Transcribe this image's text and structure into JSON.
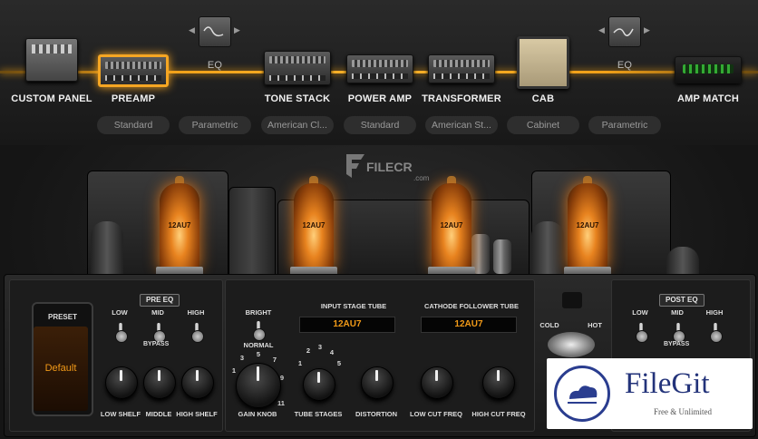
{
  "chain": {
    "modules": [
      {
        "name": "CUSTOM PANEL",
        "thumb": "panel"
      },
      {
        "name": "PREAMP",
        "thumb": "amp",
        "selected": true,
        "preset": "Standard"
      },
      {
        "name": "EQ",
        "thumb": "eq",
        "preset": "Parametric"
      },
      {
        "name": "TONE STACK",
        "thumb": "amp",
        "preset": "American Cl..."
      },
      {
        "name": "POWER AMP",
        "thumb": "amp",
        "preset": "Standard"
      },
      {
        "name": "TRANSFORMER",
        "thumb": "amp",
        "preset": "American St..."
      },
      {
        "name": "CAB",
        "thumb": "cabinet",
        "preset": "Cabinet"
      },
      {
        "name": "EQ",
        "thumb": "eq",
        "preset": "Parametric"
      },
      {
        "name": "AMP MATCH",
        "thumb": "match"
      }
    ],
    "accent": "#f5a623"
  },
  "watermark_filecr": {
    "name": "FILECR",
    "sub": ".com"
  },
  "tubes": [
    "12AU7",
    "12AU7",
    "12AU7",
    "12AU7"
  ],
  "panel": {
    "preset": {
      "title": "PRESET",
      "value": "Default"
    },
    "pre_eq": {
      "title": "PRE EQ",
      "toggles": [
        "LOW",
        "MID",
        "HIGH"
      ],
      "bypass": "BYPASS",
      "knobs": [
        "LOW SHELF",
        "MIDDLE",
        "HIGH SHELF"
      ]
    },
    "bright": {
      "top": "BRIGHT",
      "bottom": "NORMAL"
    },
    "gain": {
      "label": "GAIN KNOB",
      "scale": [
        "1",
        "3",
        "5",
        "7",
        "9",
        "11"
      ]
    },
    "tube_stages": {
      "label": "TUBE STAGES",
      "scale": [
        "1",
        "2",
        "3",
        "4",
        "5"
      ]
    },
    "input_stage": {
      "title": "INPUT STAGE TUBE",
      "value": "12AU7"
    },
    "cathode": {
      "title": "CATHODE FOLLOWER TUBE",
      "value": "12AU7"
    },
    "distortion": {
      "label": "DISTORTION"
    },
    "low_cut": {
      "label": "LOW CUT FREQ"
    },
    "high_cut": {
      "label": "HIGH CUT FREQ"
    },
    "input_switch": {
      "cold": "COLD",
      "hot": "HOT"
    },
    "post_eq": {
      "title": "POST EQ",
      "toggles": [
        "LOW",
        "MID",
        "HIGH"
      ],
      "bypass": "BYPASS"
    }
  },
  "watermark_filegit": {
    "name": "FileGit",
    "tagline": "Free & Unlimited"
  }
}
